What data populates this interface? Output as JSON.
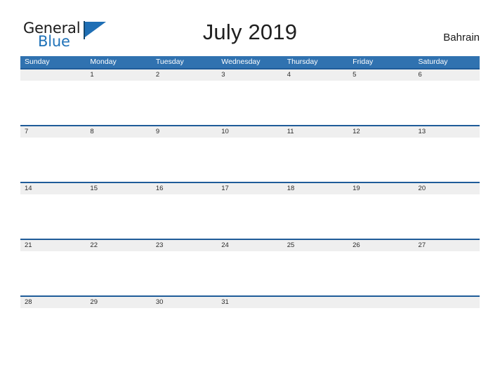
{
  "brand": {
    "name_part1": "General",
    "name_part2": "Blue",
    "color_primary": "#1f72b8",
    "color_dark": "#1a1a1a"
  },
  "header": {
    "title": "July 2019",
    "country": "Bahrain"
  },
  "colors": {
    "header_blue": "#3072b0",
    "row_border_blue": "#1f5c99",
    "date_band_gray": "#efefef",
    "text_dark": "#2b2b2b",
    "background": "#ffffff"
  },
  "calendar": {
    "weekdays": [
      "Sunday",
      "Monday",
      "Tuesday",
      "Wednesday",
      "Thursday",
      "Friday",
      "Saturday"
    ],
    "weeks": [
      {
        "days": [
          "",
          "1",
          "2",
          "3",
          "4",
          "5",
          "6"
        ]
      },
      {
        "days": [
          "7",
          "8",
          "9",
          "10",
          "11",
          "12",
          "13"
        ]
      },
      {
        "days": [
          "14",
          "15",
          "16",
          "17",
          "18",
          "19",
          "20"
        ]
      },
      {
        "days": [
          "21",
          "22",
          "23",
          "24",
          "25",
          "26",
          "27"
        ]
      },
      {
        "days": [
          "28",
          "29",
          "30",
          "31",
          "",
          "",
          ""
        ]
      }
    ]
  }
}
